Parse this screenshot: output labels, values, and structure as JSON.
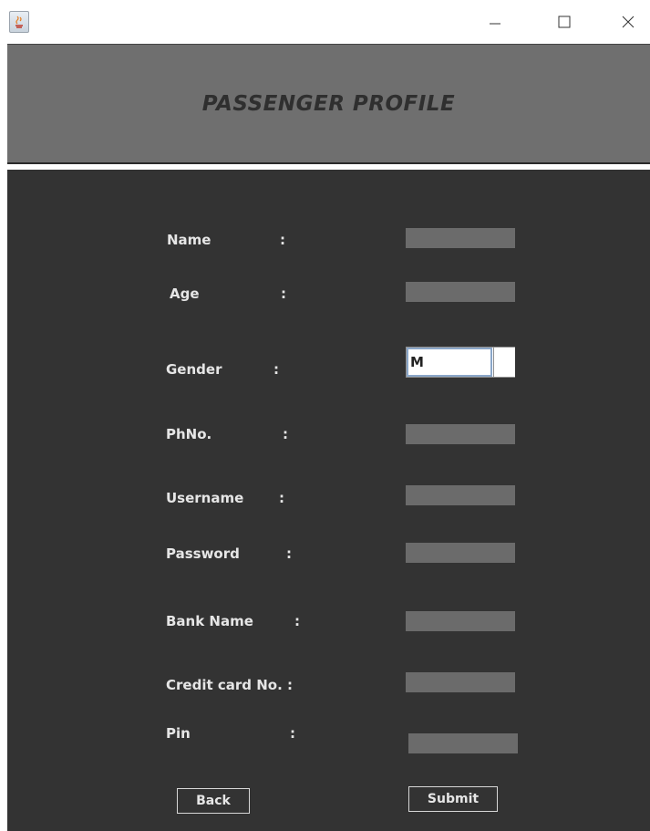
{
  "window": {
    "icon": "java-app-icon",
    "controls": {
      "minimize": "minimize-icon",
      "maximize": "maximize-icon",
      "close": "close-icon"
    }
  },
  "header": {
    "title": "PASSENGER PROFILE"
  },
  "form": {
    "name_label": "Name",
    "age_label": "Age",
    "gender_label": "Gender",
    "gender_value": "M",
    "phone_label": "PhNo.",
    "username_label": "Username",
    "password_label": "Password",
    "bank_label": "Bank Name",
    "credit_label": "Credit card No. :",
    "pin_label": "Pin",
    "colon": ":"
  },
  "buttons": {
    "back": "Back",
    "submit": "Submit"
  },
  "colors": {
    "header_bg": "#6f6f6f",
    "panel_bg": "#333333",
    "field_bg": "#6b6b6b",
    "label_text": "#e6e6e6"
  }
}
